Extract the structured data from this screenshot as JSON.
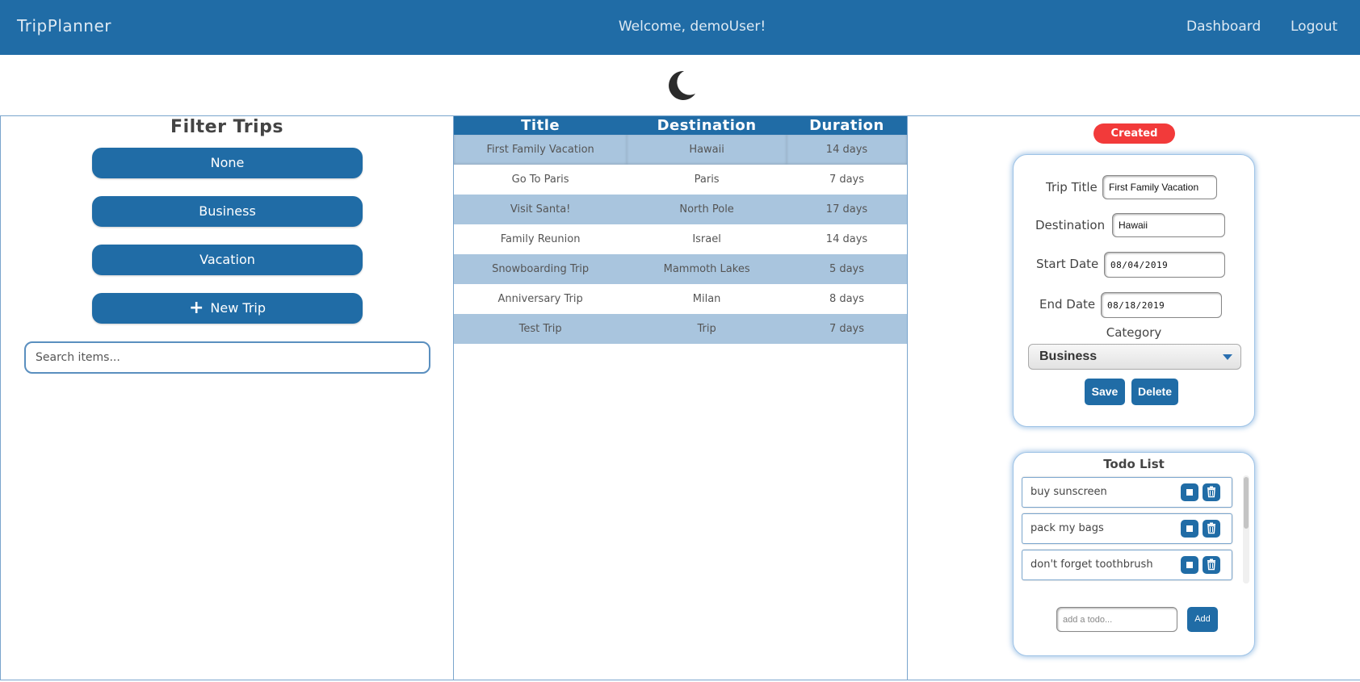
{
  "header": {
    "brand": "TripPlanner",
    "welcome": "Welcome, demoUser!",
    "links": {
      "dashboard": "Dashboard",
      "logout": "Logout"
    },
    "background_color": "#206ca6"
  },
  "theme_toggle": {
    "icon": "moon-icon"
  },
  "filter": {
    "title": "Filter Trips",
    "buttons": [
      "None",
      "Business",
      "Vacation"
    ],
    "new_trip_label": "New Trip",
    "new_trip_icon": "plus-icon",
    "search_placeholder": "Search items..."
  },
  "trips_table": {
    "columns": [
      "Title",
      "Destination",
      "Duration"
    ],
    "rows": [
      [
        "First Family Vacation",
        "Hawaii",
        "14 days"
      ],
      [
        "Go To Paris",
        "Paris",
        "7 days"
      ],
      [
        "Visit Santa!",
        "North Pole",
        "17 days"
      ],
      [
        "Family Reunion",
        "Israel",
        "14 days"
      ],
      [
        "Snowboarding Trip",
        "Mammoth Lakes",
        "5 days"
      ],
      [
        "Anniversary Trip",
        "Milan",
        "8 days"
      ],
      [
        "Test Trip",
        "Trip",
        "7 days"
      ]
    ],
    "selected_row": 0,
    "row_color": "#a9c5de"
  },
  "trip_form": {
    "status_badge": "Created",
    "status_color": "#f23a3a",
    "fields": {
      "title_label": "Trip Title",
      "title_value": "First Family Vacation",
      "destination_label": "Destination",
      "destination_value": "Hawaii",
      "start_label": "Start Date",
      "start_value": "08/04/2019",
      "end_label": "End Date",
      "end_value": "08/18/2019"
    },
    "category_label": "Category",
    "category_value": "Business",
    "save_label": "Save",
    "delete_label": "Delete"
  },
  "todo": {
    "title": "Todo List",
    "items": [
      "buy sunscreen",
      "pack my bags",
      "don't forget toothbrush"
    ],
    "input_placeholder": "add a todo...",
    "add_label": "Add"
  }
}
